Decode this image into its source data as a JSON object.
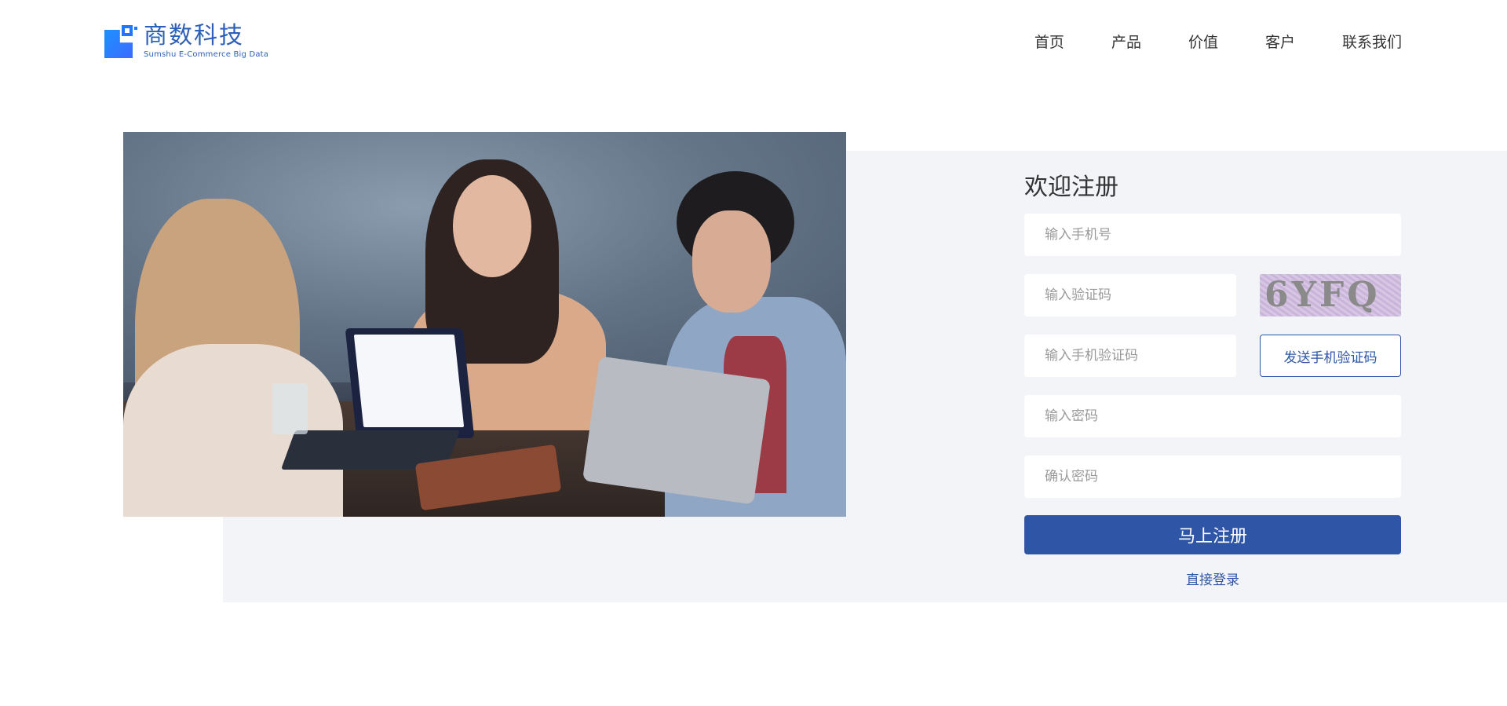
{
  "brand": {
    "name_cn": "商数科技",
    "name_en": "Sumshu E-Commerce Big Data",
    "logo_icon": "brand-logo-icon",
    "color": "#2d5fb8"
  },
  "nav": {
    "items": [
      {
        "label": "首页"
      },
      {
        "label": "产品"
      },
      {
        "label": "价值"
      },
      {
        "label": "客户"
      },
      {
        "label": "联系我们"
      }
    ]
  },
  "hero_image": {
    "description_icon": "office-team-photo"
  },
  "register": {
    "title": "欢迎注册",
    "phone_placeholder": "输入手机号",
    "captcha_placeholder": "输入验证码",
    "captcha_text": "6YFQ",
    "sms_code_placeholder": "输入手机验证码",
    "send_sms_label": "发送手机验证码",
    "password_placeholder": "输入密码",
    "confirm_password_placeholder": "确认密码",
    "submit_label": "马上注册",
    "login_link_label": "直接登录"
  },
  "colors": {
    "accent": "#2f56a6",
    "band_background": "#f2f4f8"
  }
}
